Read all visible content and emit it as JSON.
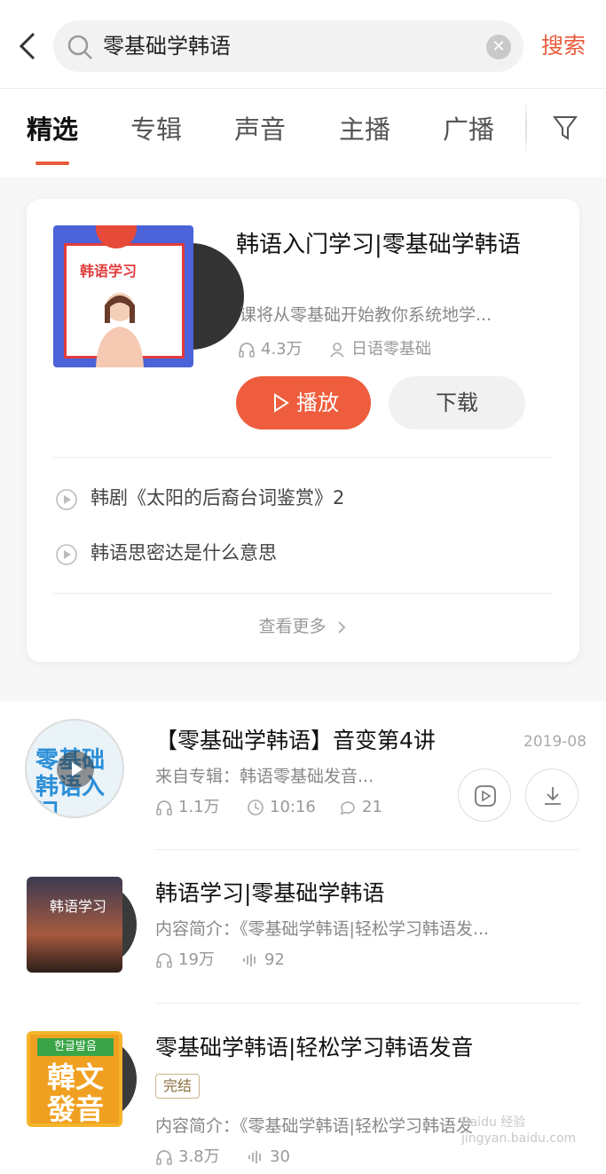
{
  "search": {
    "query": "零基础学韩语",
    "button": "搜索"
  },
  "tabs": [
    {
      "label": "精选",
      "active": true
    },
    {
      "label": "专辑"
    },
    {
      "label": "声音"
    },
    {
      "label": "主播"
    },
    {
      "label": "广播"
    }
  ],
  "album": {
    "cover_text": "韩语学习",
    "title": "韩语入门学习|零基础学韩语",
    "description": "课将从零基础开始教你系统地学...",
    "plays": "4.3万",
    "author": "日语零基础",
    "play_label": "播放",
    "download_label": "下载",
    "tracks": [
      "韩剧《太阳的后裔台词鉴赏》2",
      "韩语思密达是什么意思"
    ],
    "more": "查看更多"
  },
  "results": [
    {
      "title": "【零基础学韩语】音变第4讲",
      "date": "2019-08",
      "source": "来自专辑：韩语零基础发音...",
      "plays": "1.1万",
      "duration": "10:16",
      "comments": "21",
      "thumb_text": "零基础 韩语入门"
    },
    {
      "title": "韩语学习|零基础学韩语",
      "intro": "内容简介：《零基础学韩语|轻松学习韩语发...",
      "plays": "19万",
      "tracks": "92",
      "thumb_text": "韩语学习"
    },
    {
      "title": "零基础学韩语|轻松学习韩语发音",
      "badge": "完结",
      "intro": "内容简介：《零基础学韩语|轻松学习韩语发",
      "plays": "3.8万",
      "tracks": "30",
      "thumb_text": "韓文發音",
      "thumb_top": "한글발음"
    }
  ],
  "watermark": "Baidu 经验 jingyan.baidu.com",
  "colors": {
    "accent": "#e85d3a",
    "play_button": "#ee5d3d"
  }
}
